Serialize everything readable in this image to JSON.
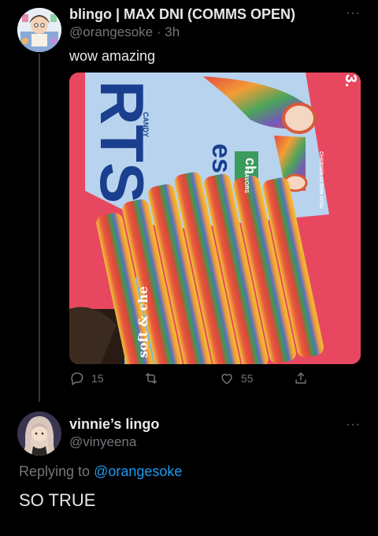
{
  "tweet1": {
    "display_name": "blingo | MAX DNI (COMMS OPEN)",
    "handle": "@orangesoke",
    "separator": "·",
    "time": "3h",
    "more": "···",
    "text": "wow amazing",
    "media_alt": "Photo of rainbow striped twist candy on a red package",
    "media_text": {
      "brand_fragment": "RTS",
      "candy": "CANDY",
      "side_fragment": "es",
      "flavor": "ch",
      "flavors": "FLAVORS",
      "size_fragment": "3.",
      "soft": "soft & che",
      "small": "CHARGED 15 SHIN VITAL"
    },
    "actions": {
      "reply_count": "15",
      "retweet_count": "",
      "like_count": "55",
      "share_count": ""
    }
  },
  "tweet2": {
    "display_name": "vinnie’s lingo",
    "handle": "@vinyeena",
    "more": "···",
    "replying_label": "Replying to",
    "replying_to": "@orangesoke",
    "text": "SO TRUE"
  },
  "colors": {
    "background": "#000000",
    "text_primary": "#e7e9ea",
    "text_secondary": "#71767b",
    "link": "#1d9bf0",
    "divider": "#333639"
  },
  "icons": [
    "reply-icon",
    "retweet-icon",
    "like-icon",
    "share-icon",
    "more-icon"
  ]
}
